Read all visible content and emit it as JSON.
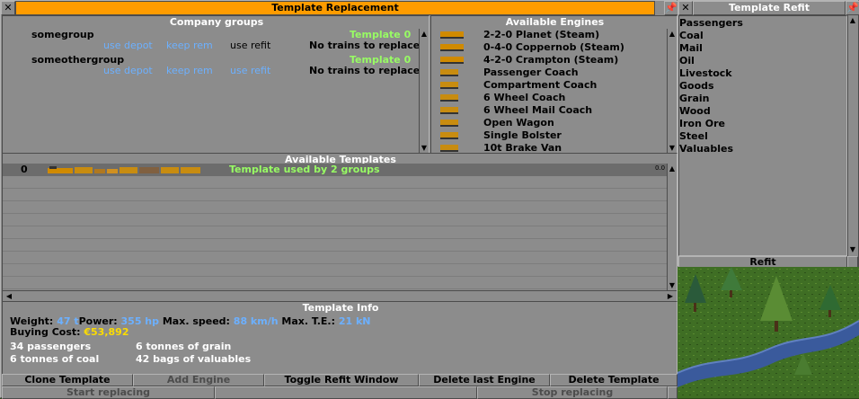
{
  "main": {
    "title": "Template Replacement",
    "company_groups_title": "Company groups",
    "available_engines_title": "Available Engines",
    "available_templates_title": "Available Templates",
    "template_info_title": "Template Info",
    "groups": [
      {
        "name": "somegroup",
        "template": "Template 0",
        "status": "No trains to replace",
        "opt1": "use depot",
        "opt2": "keep rem",
        "opt3": "use refit"
      },
      {
        "name": "someothergroup",
        "template": "Template 0",
        "status": "No trains to replace",
        "opt1": "use depot",
        "opt2": "keep rem",
        "opt3": "use refit"
      }
    ],
    "engines": [
      "2-2-0 Planet (Steam)",
      "0-4-0 Coppernob (Steam)",
      "4-2-0 Crampton (Steam)",
      "Passenger Coach",
      "Compartment Coach",
      "6 Wheel Coach",
      "6 Wheel Mail Coach",
      "Open Wagon",
      "Single Bolster",
      "10t Brake Van"
    ],
    "template_row": {
      "index": "0",
      "usage": "Template used by 2 groups",
      "ratio": "0.0"
    },
    "info": {
      "weight_label": "Weight:",
      "weight_value": "47 t",
      "power_label": "Power:",
      "power_value": "355 hp",
      "speed_label": "Max. speed:",
      "speed_value": "88 km/h",
      "te_label": "Max. T.E.:",
      "te_value": "21 kN",
      "cost_label": "Buying Cost:",
      "cost_value": "€53,892",
      "cap1": "34 passengers",
      "cap2": "6 tonnes of grain",
      "cap3": "6 tonnes of coal",
      "cap4": "42 bags of valuables"
    },
    "buttons": {
      "clone": "Clone Template",
      "add_engine": "Add Engine",
      "toggle_refit": "Toggle Refit Window",
      "delete_last": "Delete last Engine",
      "delete_template": "Delete Template",
      "start": "Start replacing",
      "stop": "Stop replacing"
    }
  },
  "refit": {
    "title": "Template Refit",
    "cargos": [
      "Passengers",
      "Coal",
      "Mail",
      "Oil",
      "Livestock",
      "Goods",
      "Grain",
      "Wood",
      "Iron Ore",
      "Steel",
      "Valuables"
    ],
    "refit_button": "Refit"
  },
  "colors": {
    "title_bar": "#ff9c00",
    "panel": "#8c8c8c",
    "selected_row": "#6c6c6c",
    "blue_text": "#6cb0ff",
    "yellow_text": "#fcdc00",
    "green_text": "#98fc64"
  }
}
